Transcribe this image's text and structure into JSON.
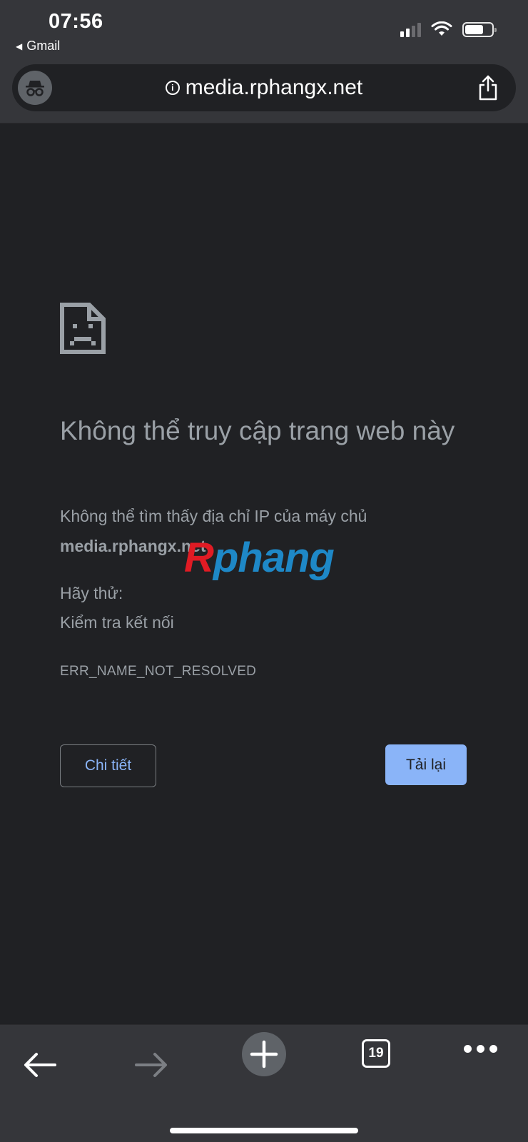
{
  "status_bar": {
    "time": "07:56",
    "back_app": "Gmail",
    "battery_level": 0.7,
    "signal_bars": 2
  },
  "url_bar": {
    "url": "media.rphangx.net",
    "mode_icon": "incognito-icon",
    "info_icon": "info-icon",
    "share_icon": "share-icon"
  },
  "error_page": {
    "icon": "sad-document-icon",
    "title": "Không thể truy cập trang web này",
    "description": "Không thể tìm thấy địa chỉ IP của máy chủ",
    "host": "media.rphangx.net",
    "try_label": "Hãy thử:",
    "try_items": [
      "Kiểm tra kết nối"
    ],
    "error_code": "ERR_NAME_NOT_RESOLVED",
    "details_button": "Chi tiết",
    "reload_button": "Tải lại"
  },
  "watermark": {
    "first_letter": "R",
    "rest": "phang"
  },
  "toolbar": {
    "back_icon": "back-arrow-icon",
    "forward_icon": "forward-arrow-icon",
    "new_tab_icon": "plus-icon",
    "tab_count": "19",
    "menu_icon": "more-dots-icon"
  },
  "colors": {
    "background": "#202124",
    "chrome": "#35363a",
    "text": "#9aa0a6",
    "link": "#8ab4f8",
    "button_primary": "#8ab4f8"
  }
}
